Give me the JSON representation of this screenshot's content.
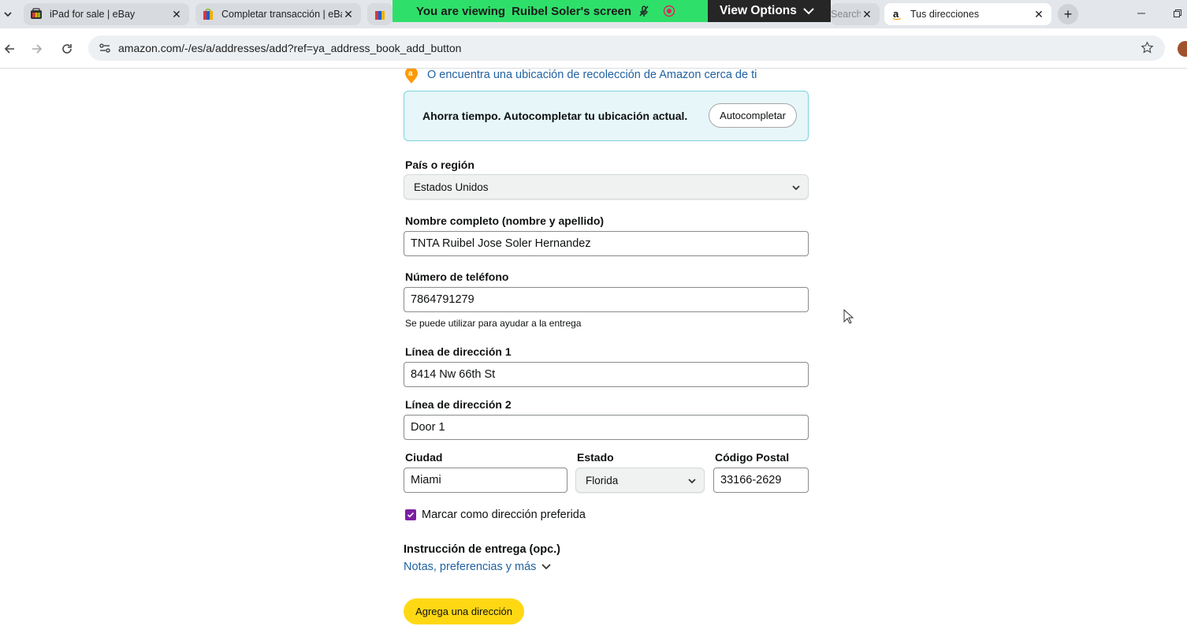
{
  "browser": {
    "tabs": [
      {
        "title": "iPad for sale | eBay",
        "icon": "ebay-favicon-icon"
      },
      {
        "title": "Completar transacción | eBay",
        "icon": "ebay-favicon-icon"
      },
      {
        "title": "",
        "icon": "ebay-favicon-icon"
      },
      {
        "title": "Search",
        "icon": "search-favicon-icon"
      },
      {
        "title": "Tus direcciones",
        "icon": "amazon-favicon-icon"
      }
    ],
    "url": "amazon.com/-/es/a/addresses/add?ref=ya_address_book_add_button"
  },
  "screen_share": {
    "banner_text": "You are viewing",
    "sharer": "Ruibel Soler's screen",
    "view_options": "View Options"
  },
  "page": {
    "pickup_link": "O encuentra una ubicación de recolección de Amazon cerca de ti",
    "autofill": {
      "message": "Ahorra tiempo. Autocompletar tu ubicación actual.",
      "button": "Autocompletar"
    },
    "country": {
      "label": "País o región",
      "value": "Estados Unidos"
    },
    "full_name": {
      "label": "Nombre completo (nombre y apellido)",
      "value": "TNTA Ruibel Jose Soler Hernandez"
    },
    "phone": {
      "label": "Número de teléfono",
      "value": "7864791279",
      "hint": "Se puede utilizar para ayudar a la entrega"
    },
    "address1": {
      "label": "Línea de dirección 1",
      "value": "8414 Nw 66th St"
    },
    "address2": {
      "label": "Línea de dirección 2",
      "value": "Door 1"
    },
    "city": {
      "label": "Ciudad",
      "value": "Miami"
    },
    "state": {
      "label": "Estado",
      "value": "Florida"
    },
    "zip": {
      "label": "Código Postal",
      "value": "33166-2629"
    },
    "preferred": {
      "label": "Marcar como dirección preferida",
      "checked": true
    },
    "delivery": {
      "label": "Instrucción de entrega (opc.)",
      "link": "Notas, preferencias y más"
    },
    "submit": "Agrega una dirección"
  },
  "colors": {
    "accent_yellow": "#ffd814",
    "link_blue": "#2162a1",
    "checkbox_purple": "#7b1fa2",
    "banner_green": "#2ee06a"
  }
}
